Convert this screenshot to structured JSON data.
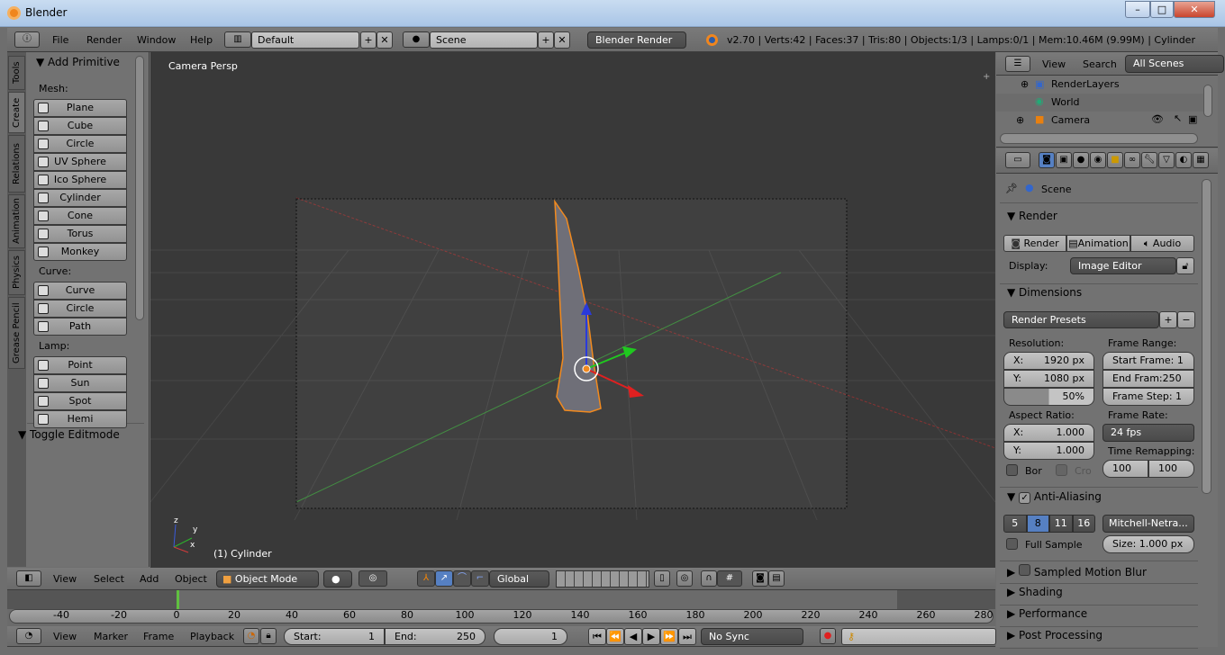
{
  "window": {
    "title": "Blender",
    "controls": [
      "–",
      "□",
      "✕"
    ]
  },
  "info_header": {
    "menus": [
      "File",
      "Render",
      "Window",
      "Help"
    ],
    "layout": "Default",
    "scene": "Scene",
    "engine": "Blender Render",
    "stats": "v2.70 | Verts:42 | Faces:37 | Tris:80 | Objects:1/3 | Lamps:0/1 | Mem:10.46M (9.99M) | Cylinder"
  },
  "toolshelf": {
    "tabs": [
      "Tools",
      "Create",
      "Relations",
      "Animation",
      "Physics",
      "Grease Pencil"
    ],
    "active_tab": "Create",
    "panel_title": "Add Primitive",
    "groups": [
      {
        "label": "Mesh:",
        "items": [
          "Plane",
          "Cube",
          "Circle",
          "UV Sphere",
          "Ico Sphere",
          "Cylinder",
          "Cone",
          "Torus",
          "Monkey"
        ]
      },
      {
        "label": "Curve:",
        "items": [
          "Curve",
          "Circle",
          "Path"
        ]
      },
      {
        "label": "Lamp:",
        "items": [
          "Point",
          "Sun",
          "Spot",
          "Hemi"
        ]
      }
    ],
    "operator_panel": "Toggle Editmode"
  },
  "viewport": {
    "view_name": "Camera Persp",
    "object_label": "(1) Cylinder",
    "axis_labels": [
      "x",
      "y",
      "z"
    ]
  },
  "view3d_header": {
    "menus": [
      "View",
      "Select",
      "Add",
      "Object"
    ],
    "mode": "Object Mode",
    "orientation": "Global"
  },
  "timeline": {
    "ticks": [
      -40,
      -20,
      0,
      20,
      40,
      60,
      80,
      100,
      120,
      140,
      160,
      180,
      200,
      220,
      240,
      260,
      280
    ],
    "current_frame": 1,
    "range_start": 1,
    "range_end": 250
  },
  "timeline_header": {
    "menus": [
      "View",
      "Marker",
      "Frame",
      "Playback"
    ],
    "start_label": "Start:",
    "start": "1",
    "end_label": "End:",
    "end": "250",
    "current": "1",
    "sync": "No Sync"
  },
  "outliner": {
    "menus": [
      "View",
      "Search"
    ],
    "filter": "All Scenes",
    "items": [
      "RenderLayers",
      "World",
      "Camera"
    ]
  },
  "properties": {
    "context": "Scene",
    "render": {
      "title": "Render",
      "buttons": [
        "Render",
        "Animation",
        "Audio"
      ],
      "display_label": "Display:",
      "display": "Image Editor"
    },
    "dimensions": {
      "title": "Dimensions",
      "presets": "Render Presets",
      "resolution_label": "Resolution:",
      "res_x": "1920 px",
      "res_y": "1080 px",
      "res_pct": "50%",
      "res_pct_value": 50,
      "frame_range_label": "Frame Range:",
      "start_frame": "Start Frame: 1",
      "end_frame": "End Fram:250",
      "frame_step": "Frame Step: 1",
      "aspect_label": "Aspect Ratio:",
      "aspect_x": "1.000",
      "aspect_y": "1.000",
      "border": "Bor",
      "crop": "Cro",
      "frame_rate_label": "Frame Rate:",
      "frame_rate": "24 fps",
      "remap_label": "Time Remapping:",
      "remap_old": "100",
      "remap_new": "100"
    },
    "aa": {
      "title": "Anti-Aliasing",
      "samples": [
        "5",
        "8",
        "11",
        "16"
      ],
      "selected": "8",
      "filter": "Mitchell-Netra...",
      "full_sample": "Full Sample",
      "size": "Size: 1.000 px"
    },
    "collapsed": [
      "Sampled Motion Blur",
      "Shading",
      "Performance",
      "Post Processing"
    ]
  },
  "colors": {
    "accent": "#5680c2",
    "selection": "#f28a1e",
    "viewport_bg": "#393939"
  }
}
